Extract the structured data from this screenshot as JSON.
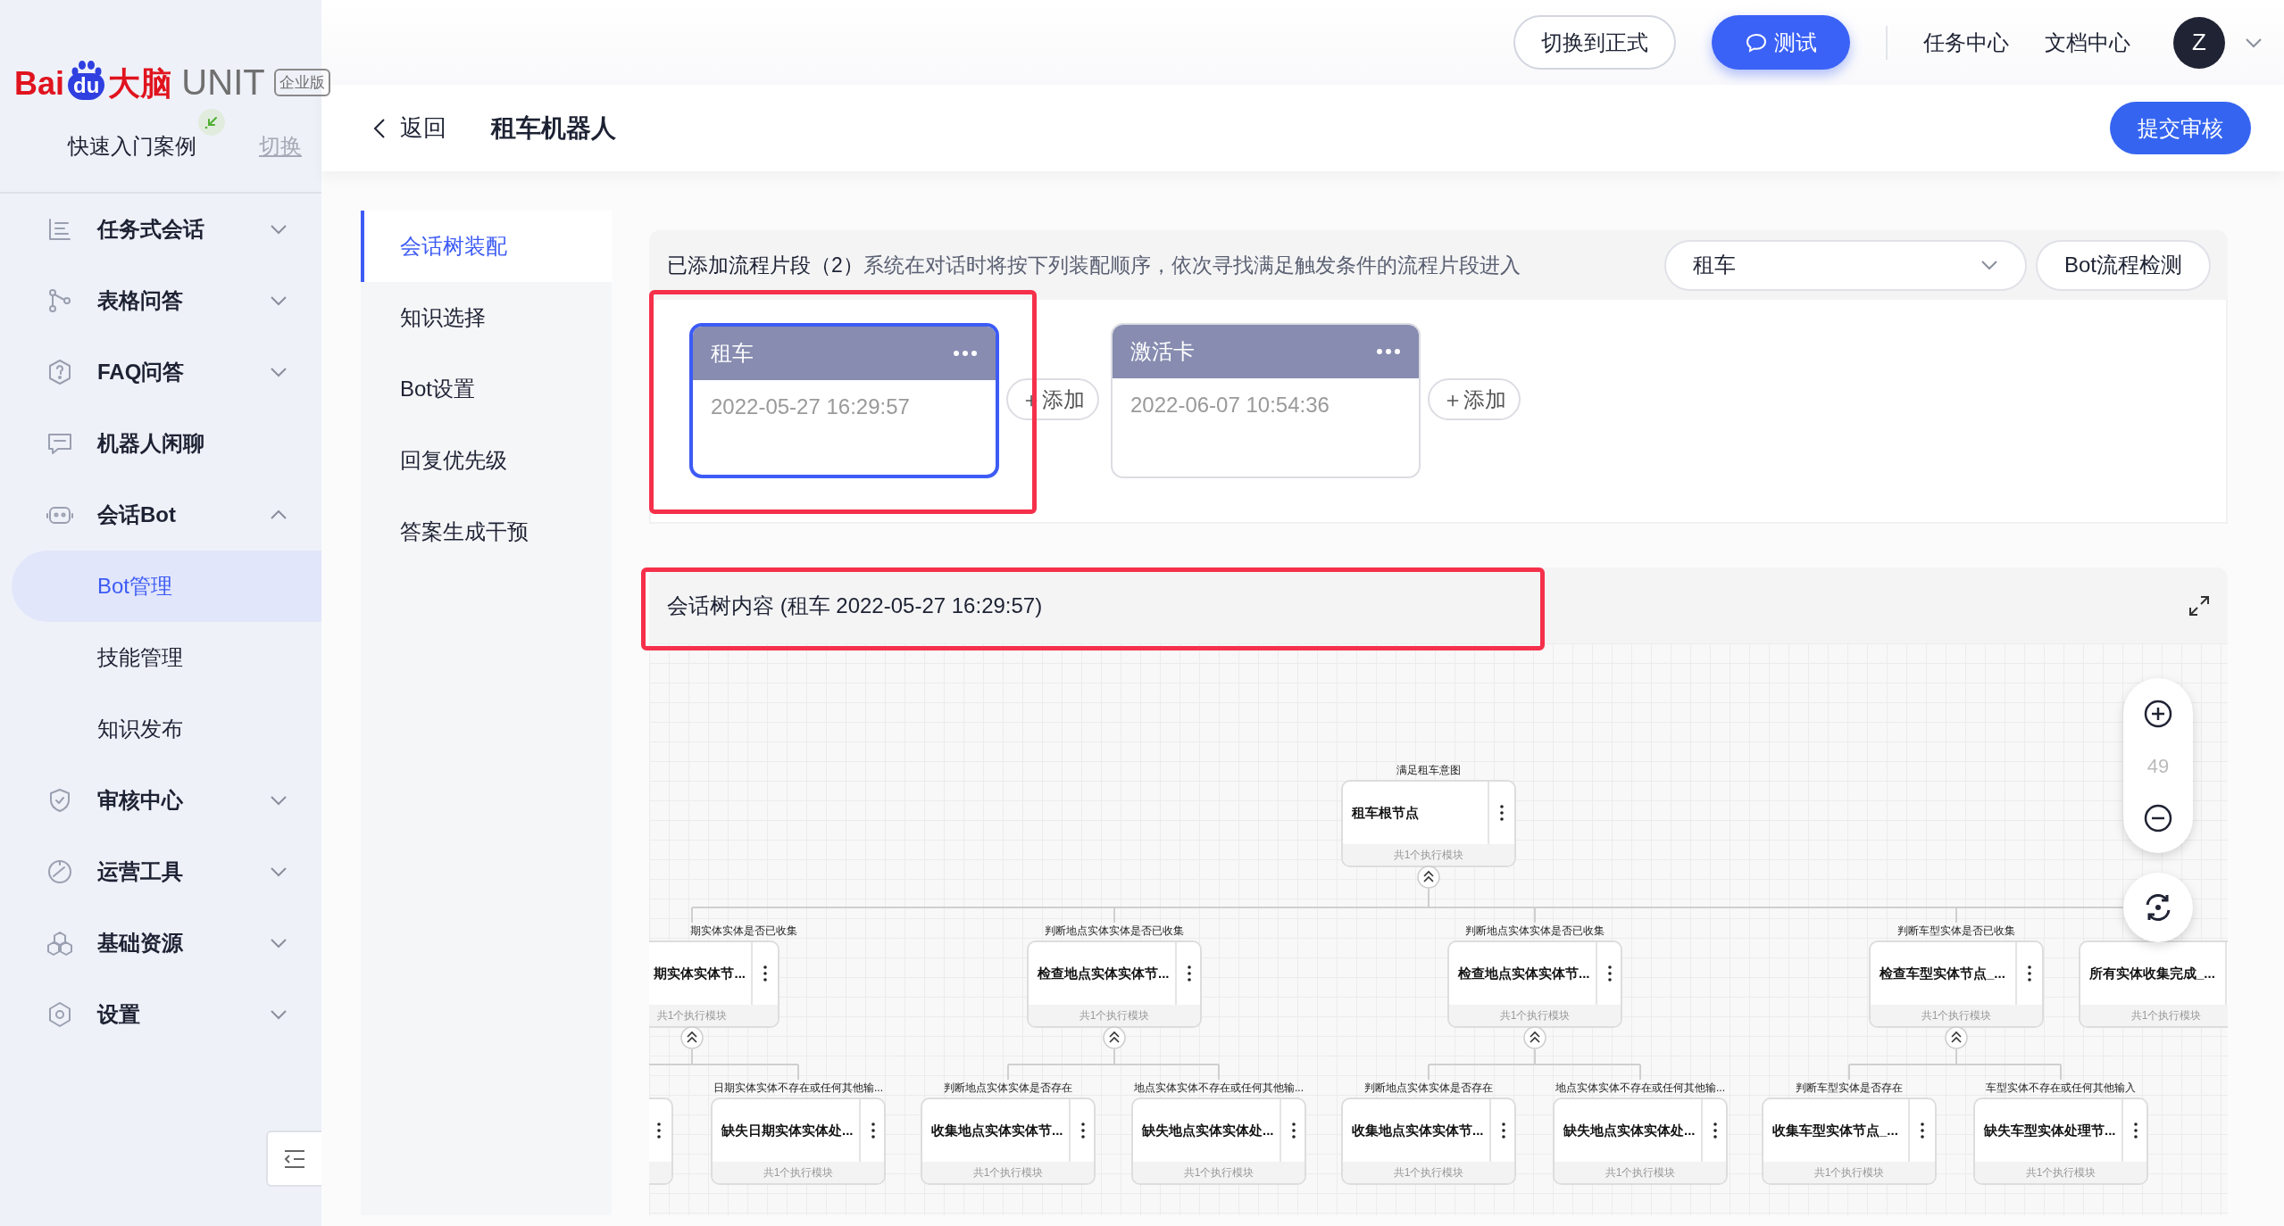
{
  "sidebar": {
    "logo": {
      "brand": "Bai",
      "paw": "du",
      "suffix": "大脑",
      "product": "UNIT",
      "edition": "企业版"
    },
    "project": {
      "name": "快速入门案例",
      "switch": "切换"
    },
    "items": [
      {
        "kind": "group",
        "label": "任务式会话",
        "expanded": false
      },
      {
        "kind": "group",
        "label": "表格问答",
        "expanded": false
      },
      {
        "kind": "group",
        "label": "FAQ问答",
        "expanded": false
      },
      {
        "kind": "link",
        "label": "机器人闲聊"
      },
      {
        "kind": "group",
        "label": "会话Bot",
        "expanded": true,
        "children": [
          {
            "label": "Bot管理",
            "selected": true
          },
          {
            "label": "技能管理",
            "selected": false
          },
          {
            "label": "知识发布",
            "selected": false
          }
        ]
      },
      {
        "kind": "group",
        "label": "审核中心",
        "expanded": false
      },
      {
        "kind": "group",
        "label": "运营工具",
        "expanded": false
      },
      {
        "kind": "group",
        "label": "基础资源",
        "expanded": false
      },
      {
        "kind": "group",
        "label": "设置",
        "expanded": false
      }
    ]
  },
  "header": {
    "buttons": [
      {
        "label": "切换到正式",
        "kind": "outline"
      },
      {
        "label": "测试",
        "kind": "primary"
      }
    ],
    "links": [
      "任务中心",
      "文档中心"
    ],
    "avatar": "Z"
  },
  "page": {
    "back": "返回",
    "title": "租车机器人",
    "submit": "提交审核"
  },
  "subnav": [
    {
      "label": "会话树装配",
      "selected": true
    },
    {
      "label": "知识选择",
      "selected": false
    },
    {
      "label": "Bot设置",
      "selected": false
    },
    {
      "label": "回复优先级",
      "selected": false
    },
    {
      "label": "答案生成干预",
      "selected": false
    }
  ],
  "fragments": {
    "heading": "已添加流程片段（2）",
    "description": "系统在对话时将按下列装配顺序，依次寻找满足触发条件的流程片段进入",
    "select": "租车",
    "check_button": "Bot流程检测",
    "items": [
      {
        "title": "租车",
        "time": "2022-05-27 16:29:57",
        "selected": true,
        "add": "＋添加"
      },
      {
        "title": "激活卡",
        "time": "2022-06-07 10:54:36",
        "selected": false,
        "add": "＋添加"
      }
    ]
  },
  "tree": {
    "title": "会话树内容 (租车 2022-05-27 16:29:57)",
    "zoom": "49",
    "root": {
      "kind": "node",
      "label": "满足租车意图",
      "title": "租车根节点",
      "footer": "共1个执行模块",
      "expanded": true,
      "children": [
        {
          "kind": "node",
          "label": "期实体实体是否已收集",
          "title": "期实体实体节...",
          "footer": "共1个执行模块",
          "expanded": true,
          "children": [
            {
              "kind": "cut"
            },
            {
              "kind": "node",
              "label": "日期实体实体不存在或任何其他输...",
              "title": "缺失日期实体实体处...",
              "footer": "共1个执行模块"
            }
          ]
        },
        {
          "kind": "node",
          "label": "判断地点实体实体是否已收集",
          "title": "检查地点实体实体节...",
          "footer": "共1个执行模块",
          "expanded": true,
          "children": [
            {
              "kind": "node",
              "label": "判断地点实体实体是否存在",
              "title": "收集地点实体实体节...",
              "footer": "共1个执行模块"
            },
            {
              "kind": "node",
              "label": "地点实体实体不存在或任何其他输...",
              "title": "缺失地点实体实体处...",
              "footer": "共1个执行模块"
            }
          ]
        },
        {
          "kind": "node",
          "label": "判断地点实体实体是否已收集",
          "title": "检查地点实体实体节...",
          "footer": "共1个执行模块",
          "expanded": true,
          "children": [
            {
              "kind": "node",
              "label": "判断地点实体实体是否存在",
              "title": "收集地点实体实体节...",
              "footer": "共1个执行模块"
            },
            {
              "kind": "node",
              "label": "地点实体实体不存在或任何其他输...",
              "title": "缺失地点实体实体处...",
              "footer": "共1个执行模块"
            }
          ]
        },
        {
          "kind": "node",
          "label": "判断车型实体是否已收集",
          "title": "检查车型实体节点_...",
          "footer": "共1个执行模块",
          "expanded": true,
          "children": [
            {
              "kind": "node",
              "label": "判断车型实体是否存在",
              "title": "收集车型实体节点_...",
              "footer": "共1个执行模块"
            },
            {
              "kind": "node",
              "label": "车型实体不存在或任何其他输入",
              "title": "缺失车型实体处理节...",
              "footer": "共1个执行模块"
            }
          ]
        },
        {
          "kind": "node",
          "title": "所有实体收集完成_...",
          "footer": "共1个执行模块"
        }
      ]
    }
  }
}
